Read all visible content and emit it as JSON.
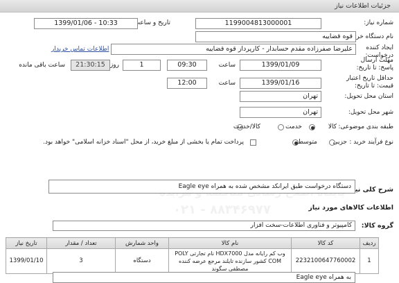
{
  "header": {
    "title": "جزئیات اطلاعات نیاز"
  },
  "fields": {
    "need_number": {
      "label": "شماره نیاز:",
      "value": "1199004813000001"
    },
    "announce_date": {
      "label": "تاریخ و ساعت اعلان عمومی:",
      "value": "1399/01/06 - 10:33"
    },
    "buyer_org": {
      "label": "نام دستگاه خریدار:",
      "value": "قوه قضاییه"
    },
    "requester": {
      "label": "ایجاد کننده درخواست:",
      "value": "علیرضا  صفرزاده مقدم  حسابدار - کارپرداز قوه قضاییه",
      "contact_link": "اطلاعات تماس خریدار"
    },
    "reply_deadline": {
      "label": "مهلت ارسال پاسخ: تا تاریخ:",
      "date": "1399/01/09",
      "time_label": "ساعت",
      "time": "09:30",
      "days": "1",
      "days_label": "روز و",
      "remaining": "21:30:15",
      "remaining_label": "ساعت باقی مانده"
    },
    "price_validity": {
      "label": "حداقل تاریخ اعتبار قیمت: تا تاریخ:",
      "date": "1399/01/16",
      "time_label": "ساعت",
      "time": "12:00"
    },
    "delivery_province": {
      "label": "استان محل تحویل:",
      "value": "تهران"
    },
    "delivery_city": {
      "label": "شهر محل تحویل:",
      "value": "تهران"
    },
    "category": {
      "label": "طبقه بندی موضوعی:",
      "options": [
        "کالا",
        "خدمت",
        "کالا/خدمت"
      ],
      "selected": "کالا"
    },
    "purchase_type": {
      "label": "نوع فرآیند خرید :",
      "options": [
        "جزیی",
        "متوسط"
      ],
      "selected": "متوسط",
      "payment_note": "پرداخت تمام یا بخشی از مبلغ خرید، از محل \"اسناد خزانه اسلامی\" خواهد بود."
    }
  },
  "summary": {
    "label": "شرح کلی نیاز:",
    "value": "دستگاه درخواست طبق ایرانکد مشخص شده به همراه Eagle eye"
  },
  "goods_section_title": "اطلاعات کالاهای مورد نیاز",
  "goods_group": {
    "label": "گروه کالا:",
    "value": "کامپیوتر و فناوری اطلاعات-سخت افزار"
  },
  "table": {
    "headers": [
      "ردیف",
      "کد کالا",
      "نام کالا",
      "واحد شمارش",
      "تعداد / مقدار",
      "تاریخ نیاز"
    ],
    "rows": [
      {
        "row": "1",
        "code": "2232100647760002",
        "name": "وب کم رایانه مدل HDX7000 نام تجارتی POLY COM کشور سازنده تایلند مرجع عرضه کننده مصطفی سگوند",
        "unit": "دستگاه",
        "qty": "3",
        "date": "1399/01/10"
      }
    ]
  },
  "buyer_notes": {
    "value": "به همراه Eagle eye"
  },
  "watermark": {
    "line1": "پایگاه اطلاع رسانی مناقصه و مزایده",
    "line2": "۰۲۱ - ۸۸۳۴۶۹۷۷"
  }
}
